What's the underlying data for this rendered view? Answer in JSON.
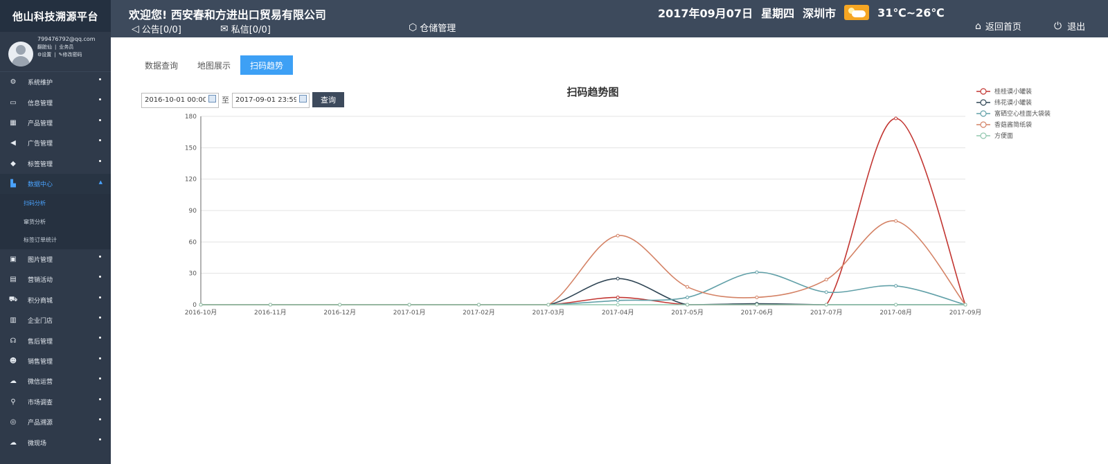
{
  "app": {
    "brand": "他山科技溯源平台"
  },
  "user": {
    "email": "799476792@qq.com",
    "line1a": "翻脏仙",
    "line1b": "业务员",
    "settings": "设置",
    "change_password": "修改密码"
  },
  "header": {
    "company": "欢迎您! 西安春和方进出口贸易有限公司",
    "notice": "公告[0/0]",
    "message": "私信[0/0]",
    "warehouse": "仓储管理",
    "date": "2017年09月07日",
    "weekday": "星期四",
    "city": "深圳市",
    "temperature": "31℃~26℃",
    "home": "返回首页",
    "logout": "退出"
  },
  "sidebar": {
    "items": [
      {
        "label": "系统维护",
        "icon": "gear-icon",
        "glyph": "⚙"
      },
      {
        "label": "信息管理",
        "icon": "keyboard-icon",
        "glyph": "▭"
      },
      {
        "label": "产品管理",
        "icon": "grid-icon",
        "glyph": "▦"
      },
      {
        "label": "广告管理",
        "icon": "megaphone-icon",
        "glyph": "◀"
      },
      {
        "label": "标签管理",
        "icon": "tag-icon",
        "glyph": "◆"
      },
      {
        "label": "数据中心",
        "icon": "bar-chart-icon",
        "glyph": "▙"
      }
    ],
    "sub_items": [
      "扫码分析",
      "窜货分析",
      "标签订单统计"
    ],
    "items_after": [
      {
        "label": "图片管理",
        "icon": "image-icon",
        "glyph": "▣"
      },
      {
        "label": "营销活动",
        "icon": "gift-icon",
        "glyph": "▤"
      },
      {
        "label": "积分商城",
        "icon": "cart-icon",
        "glyph": "⛟"
      },
      {
        "label": "企业门店",
        "icon": "store-icon",
        "glyph": "▥"
      },
      {
        "label": "售后管理",
        "icon": "headset-icon",
        "glyph": "☊"
      },
      {
        "label": "销售管理",
        "icon": "users-icon",
        "glyph": "☻"
      },
      {
        "label": "微信运营",
        "icon": "wechat-icon",
        "glyph": "☁"
      },
      {
        "label": "市场调查",
        "icon": "search-icon",
        "glyph": "⚲"
      },
      {
        "label": "产品溯源",
        "icon": "database-icon",
        "glyph": "◎"
      },
      {
        "label": "微现场",
        "icon": "cloud-icon",
        "glyph": "☁"
      }
    ]
  },
  "tabs": [
    "数据查询",
    "地图展示",
    "扫码趋势"
  ],
  "query": {
    "start": "2016-10-01 00:00",
    "separator": "至",
    "end": "2017-09-01 23:59",
    "button": "查询"
  },
  "colors": {
    "sidebar": "#2f3a4a",
    "header": "#3d4a5c",
    "accent": "#3da0f5"
  },
  "chart_data": {
    "type": "line",
    "title": "扫码趋势图",
    "categories": [
      "2016-10月",
      "2016-11月",
      "2016-12月",
      "2017-01月",
      "2017-02月",
      "2017-03月",
      "2017-04月",
      "2017-05月",
      "2017-06月",
      "2017-07月",
      "2017-08月",
      "2017-09月"
    ],
    "ylim": [
      0,
      180
    ],
    "yticks": [
      0,
      30,
      60,
      90,
      120,
      150,
      180
    ],
    "grid": true,
    "legend_position": "top-right",
    "series": [
      {
        "name": "桂桂谟小罐装",
        "color": "#c23531",
        "values": [
          0,
          0,
          0,
          0,
          0,
          0,
          7,
          0,
          0,
          0,
          178,
          0
        ]
      },
      {
        "name": "纬花谟小罐装",
        "color": "#2f4554",
        "values": [
          0,
          0,
          0,
          0,
          0,
          0,
          25,
          0,
          1,
          0,
          0,
          0
        ]
      },
      {
        "name": "富硒空心桂面大袋装",
        "color": "#61a0a8",
        "values": [
          0,
          0,
          0,
          0,
          0,
          0,
          4,
          7,
          31,
          12,
          18,
          0
        ]
      },
      {
        "name": "香菇酱简纸袋",
        "color": "#d48265",
        "values": [
          0,
          0,
          0,
          0,
          0,
          0,
          66,
          17,
          7,
          24,
          80,
          0
        ]
      },
      {
        "name": "方便面",
        "color": "#91c7ae",
        "values": [
          0,
          0,
          0,
          0,
          0,
          0,
          0,
          0,
          0,
          0,
          0,
          0
        ]
      }
    ]
  }
}
